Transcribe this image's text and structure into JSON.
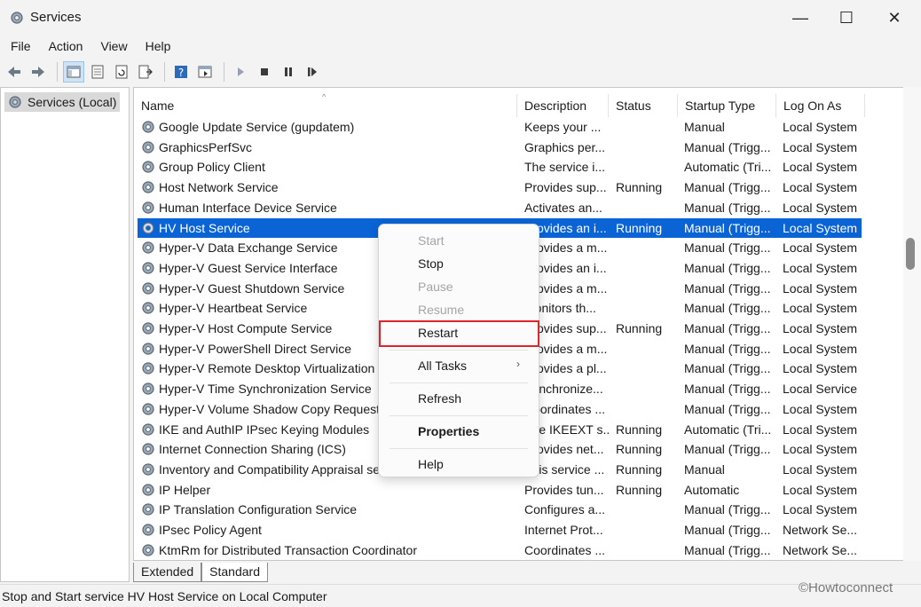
{
  "window": {
    "title": "Services",
    "min": "—",
    "max": "☐",
    "close": "✕"
  },
  "menu": [
    "File",
    "Action",
    "View",
    "Help"
  ],
  "toolbar_icons": [
    "back-icon",
    "forward-icon",
    "show-hide-tree-icon",
    "properties-icon",
    "refresh-icon",
    "export-icon",
    "help-icon",
    "show-action-pane-icon",
    "play-icon",
    "stop-icon",
    "pause-icon",
    "resume-icon"
  ],
  "tree": {
    "root": "Services (Local)"
  },
  "columns": {
    "name": "Name",
    "description": "Description",
    "status": "Status",
    "startup": "Startup Type",
    "logon": "Log On As",
    "sort_caret": "^"
  },
  "rows": [
    {
      "name": "Google Update Service (gupdatem)",
      "description": "Keeps your ...",
      "status": "",
      "startup": "Manual",
      "logon": "Local System"
    },
    {
      "name": "GraphicsPerfSvc",
      "description": "Graphics per...",
      "status": "",
      "startup": "Manual (Trigg...",
      "logon": "Local System"
    },
    {
      "name": "Group Policy Client",
      "description": "The service i...",
      "status": "",
      "startup": "Automatic (Tri...",
      "logon": "Local System"
    },
    {
      "name": "Host Network Service",
      "description": "Provides sup...",
      "status": "Running",
      "startup": "Manual (Trigg...",
      "logon": "Local System"
    },
    {
      "name": "Human Interface Device Service",
      "description": "Activates an...",
      "status": "",
      "startup": "Manual (Trigg...",
      "logon": "Local System"
    },
    {
      "name": "HV Host Service",
      "description": "Provides an i...",
      "status": "Running",
      "startup": "Manual (Trigg...",
      "logon": "Local System",
      "selected": true
    },
    {
      "name": "Hyper-V Data Exchange Service",
      "description": "Provides a m...",
      "status": "",
      "startup": "Manual (Trigg...",
      "logon": "Local System"
    },
    {
      "name": "Hyper-V Guest Service Interface",
      "description": "Provides an i...",
      "status": "",
      "startup": "Manual (Trigg...",
      "logon": "Local System"
    },
    {
      "name": "Hyper-V Guest Shutdown Service",
      "description": "Provides a m...",
      "status": "",
      "startup": "Manual (Trigg...",
      "logon": "Local System"
    },
    {
      "name": "Hyper-V Heartbeat Service",
      "description": "Monitors th...",
      "status": "",
      "startup": "Manual (Trigg...",
      "logon": "Local System"
    },
    {
      "name": "Hyper-V Host Compute Service",
      "description": "Provides sup...",
      "status": "Running",
      "startup": "Manual (Trigg...",
      "logon": "Local System"
    },
    {
      "name": "Hyper-V PowerShell Direct Service",
      "description": "Provides a m...",
      "status": "",
      "startup": "Manual (Trigg...",
      "logon": "Local System"
    },
    {
      "name": "Hyper-V Remote Desktop Virtualization Service",
      "description": "Provides a pl...",
      "status": "",
      "startup": "Manual (Trigg...",
      "logon": "Local System"
    },
    {
      "name": "Hyper-V Time Synchronization Service",
      "description": "Synchronize...",
      "status": "",
      "startup": "Manual (Trigg...",
      "logon": "Local Service"
    },
    {
      "name": "Hyper-V Volume Shadow Copy Requestor",
      "description": "Coordinates ...",
      "status": "",
      "startup": "Manual (Trigg...",
      "logon": "Local System"
    },
    {
      "name": "IKE and AuthIP IPsec Keying Modules",
      "description": "The IKEEXT s...",
      "status": "Running",
      "startup": "Automatic (Tri...",
      "logon": "Local System"
    },
    {
      "name": "Internet Connection Sharing (ICS)",
      "description": "Provides net...",
      "status": "Running",
      "startup": "Manual (Trigg...",
      "logon": "Local System"
    },
    {
      "name": "Inventory and Compatibility Appraisal service",
      "description": "This service ...",
      "status": "Running",
      "startup": "Manual",
      "logon": "Local System"
    },
    {
      "name": "IP Helper",
      "description": "Provides tun...",
      "status": "Running",
      "startup": "Automatic",
      "logon": "Local System"
    },
    {
      "name": "IP Translation Configuration Service",
      "description": "Configures a...",
      "status": "",
      "startup": "Manual (Trigg...",
      "logon": "Local System"
    },
    {
      "name": "IPsec Policy Agent",
      "description": "Internet Prot...",
      "status": "",
      "startup": "Manual (Trigg...",
      "logon": "Network Se..."
    },
    {
      "name": "KtmRm for Distributed Transaction Coordinator",
      "description": "Coordinates ...",
      "status": "",
      "startup": "Manual (Trigg...",
      "logon": "Network Se..."
    }
  ],
  "context_menu": {
    "start": "Start",
    "stop": "Stop",
    "pause": "Pause",
    "resume": "Resume",
    "restart": "Restart",
    "all_tasks": "All Tasks",
    "all_tasks_arrow": "›",
    "refresh": "Refresh",
    "properties": "Properties",
    "help": "Help"
  },
  "tabs": {
    "extended": "Extended",
    "standard": "Standard"
  },
  "statusbar": "Stop and Start service HV Host Service on Local Computer",
  "watermark": "©Howtoconnect",
  "colors": {
    "selection": "#0a64d6",
    "highlight_box": "#e0242b"
  }
}
